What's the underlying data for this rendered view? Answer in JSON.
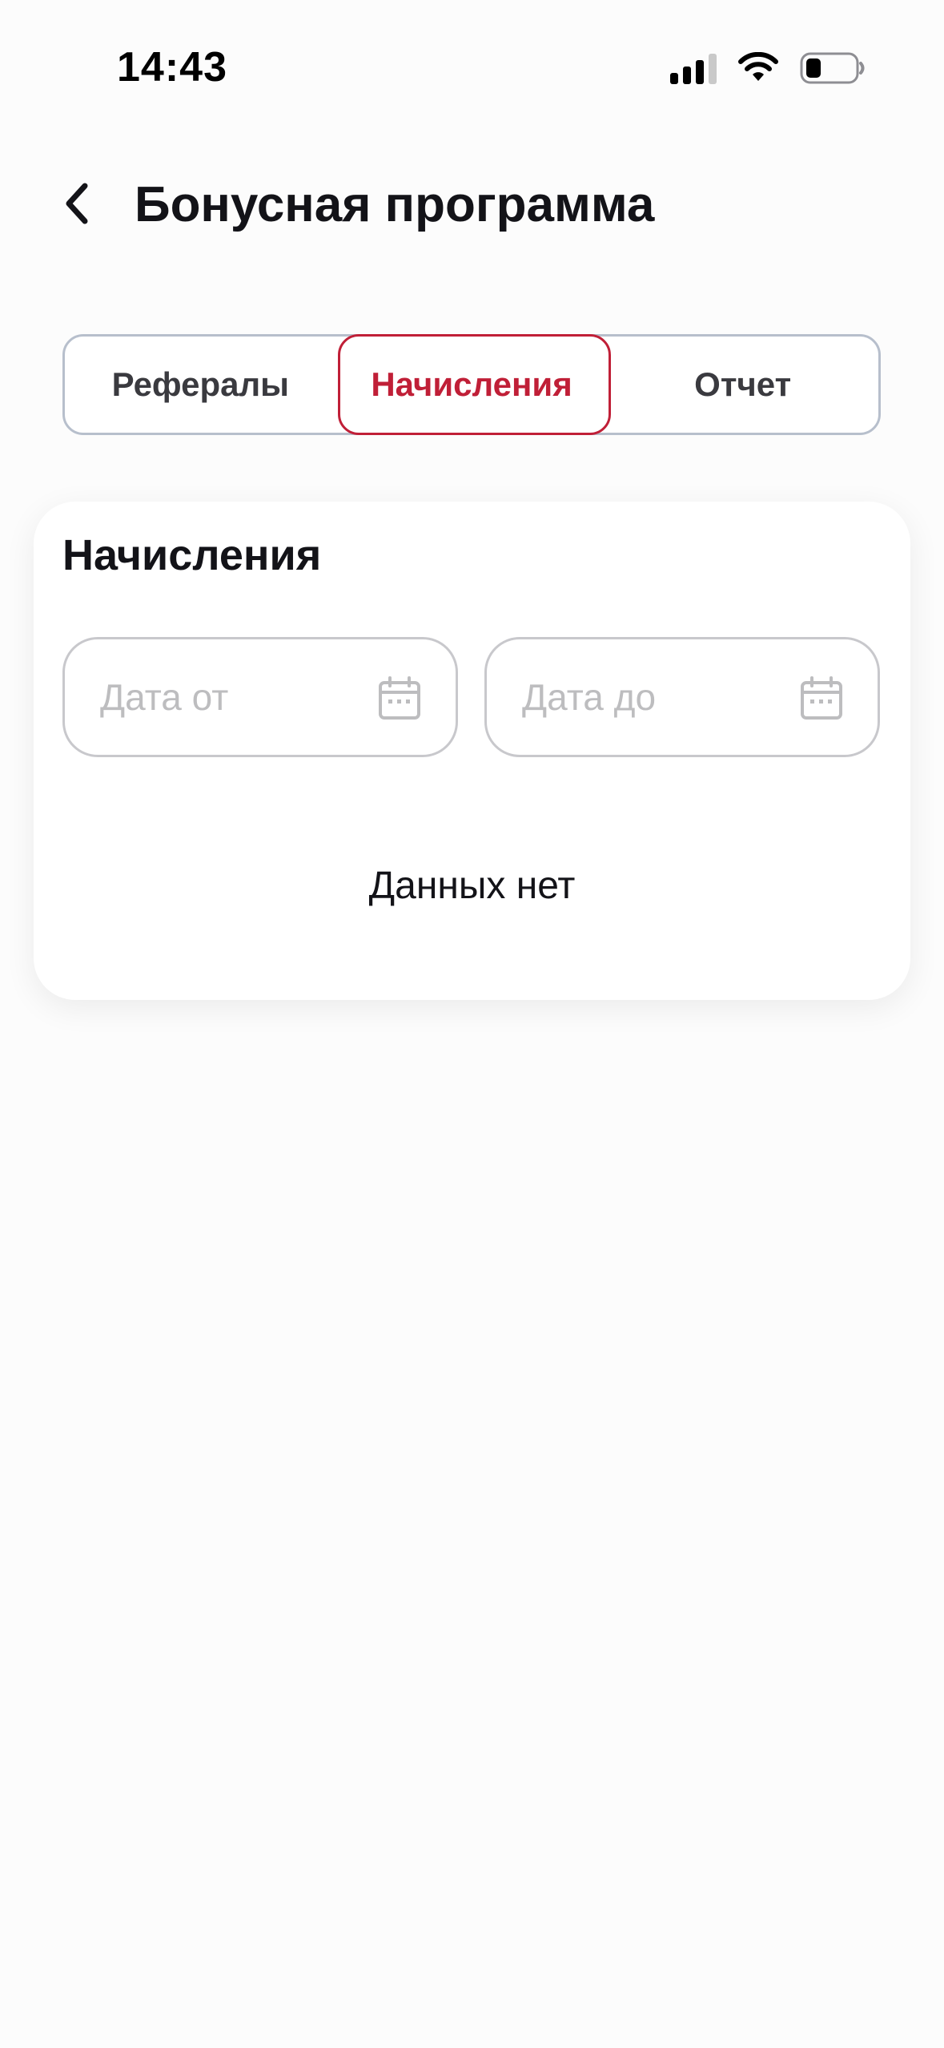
{
  "status_bar": {
    "time": "14:43",
    "icons": [
      "signal-icon",
      "wifi-icon",
      "battery-icon"
    ]
  },
  "header": {
    "back_icon": "chevron-left-icon",
    "title": "Бонусная программа"
  },
  "tabs": [
    {
      "label": "Рефералы",
      "active": false
    },
    {
      "label": "Начисления",
      "active": true
    },
    {
      "label": "Отчет",
      "active": false
    }
  ],
  "card": {
    "title": "Начисления",
    "date_from": {
      "placeholder": "Дата от",
      "value": "",
      "icon": "calendar-icon"
    },
    "date_to": {
      "placeholder": "Дата до",
      "value": "",
      "icon": "calendar-icon"
    },
    "empty_message": "Данных нет"
  },
  "colors": {
    "accent": "#c01f37",
    "tab_border": "#b7bfcc",
    "field_border": "#c8c8cc",
    "placeholder": "#bdbdbf",
    "background": "#fcfcfc"
  }
}
